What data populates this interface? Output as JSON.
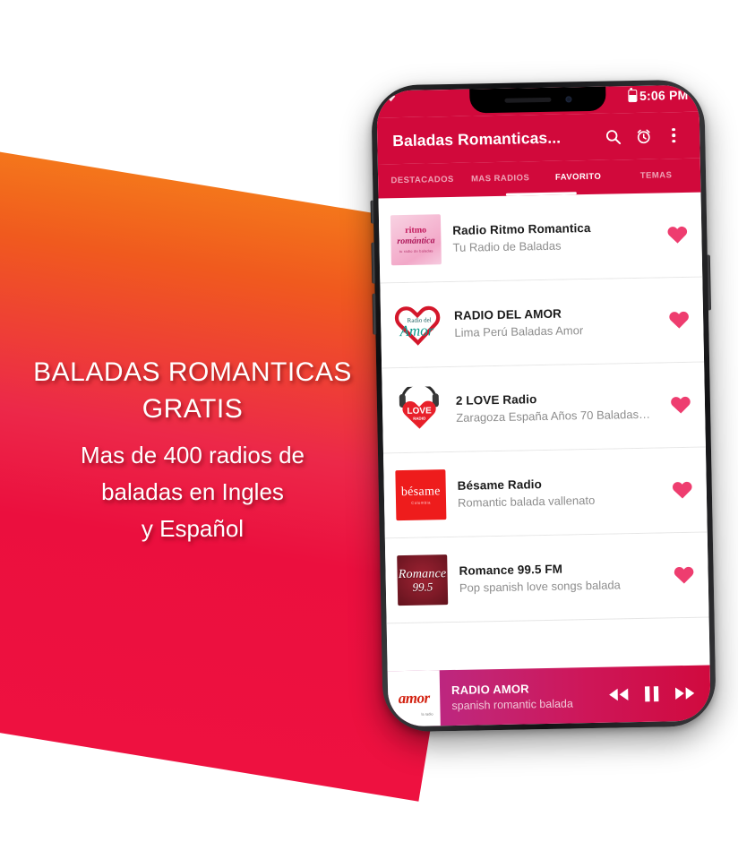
{
  "promo": {
    "title": "BALADAS ROMANTICAS\nGRATIS",
    "subtitle": "Mas de 400 radios de\nbaladas en Ingles\ny Español",
    "gradient_top": "#F4761B",
    "gradient_bottom": "#EE1140"
  },
  "phone": {
    "status_bar": {
      "time": "5:06 PM",
      "signal_icon": "wifi-icon",
      "battery_icon": "battery-icon",
      "background": "#D1093B"
    },
    "app_bar": {
      "title": "Baladas Romanticas...",
      "background": "#D1093B",
      "actions": [
        {
          "name": "search-icon",
          "label": "Search"
        },
        {
          "name": "alarm-icon",
          "label": "Sleep timer"
        },
        {
          "name": "overflow-menu-icon",
          "label": "More options"
        }
      ]
    },
    "tabs": {
      "items": [
        {
          "label": "DESTACADOS",
          "active": false
        },
        {
          "label": "MAS RADIOS",
          "active": false
        },
        {
          "label": "FAVORITO",
          "active": true
        },
        {
          "label": "TEMAS",
          "active": false
        }
      ],
      "indicator_color": "#FFFFFF"
    },
    "stations": [
      {
        "title": "Radio Ritmo Romantica",
        "subtitle": "Tu Radio de Baladas",
        "logo": "radio-ritmo-romantica-logo",
        "logo_text": {
          "line1": "ritmo",
          "line2": "romántica",
          "line3": "tu radio de baladas"
        },
        "favorite": true
      },
      {
        "title": "RADIO DEL AMOR",
        "subtitle": "Lima Perú Baladas Amor",
        "logo": "radio-del-amor-logo",
        "logo_text": {
          "line1": "Radio del",
          "line2": "Amor"
        },
        "favorite": true
      },
      {
        "title": "2 LOVE Radio",
        "subtitle": "Zaragoza España Años 70 Baladas…",
        "logo": "love-radio-logo",
        "logo_text": {
          "line1": "LOVE",
          "line2": "RADIO"
        },
        "favorite": true
      },
      {
        "title": "Bésame Radio",
        "subtitle": "Romantic balada vallenato",
        "logo": "besame-radio-logo",
        "logo_text": {
          "line1": "bésame",
          "line2": "Colombia"
        },
        "favorite": true
      },
      {
        "title": "Romance 99.5 FM",
        "subtitle": "Pop spanish love songs balada",
        "logo": "romance-995-logo",
        "logo_text": {
          "line1": "Romance",
          "line2": "99.5"
        },
        "favorite": true
      }
    ],
    "favorite_color": "#EE3D6F",
    "player": {
      "station": "RADIO AMOR",
      "description": "spanish romantic balada",
      "logo": "radio-amor-logo",
      "logo_text": "amor",
      "logo_subtext": "la radio",
      "controls": [
        {
          "name": "rewind-button",
          "label": "Rewind"
        },
        {
          "name": "pause-button",
          "label": "Pause"
        },
        {
          "name": "forward-button",
          "label": "Forward"
        }
      ],
      "gradient_start": "#B5298E",
      "gradient_end": "#D00A3E"
    }
  }
}
